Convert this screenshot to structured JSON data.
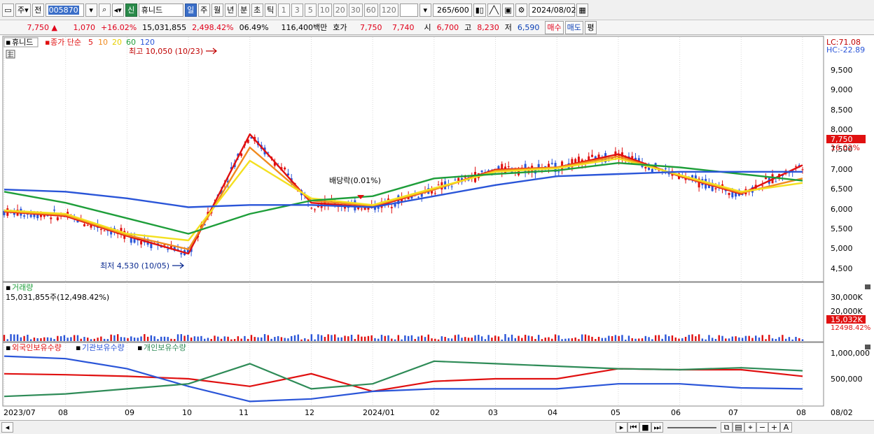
{
  "toolbar": {
    "market_btn": "주",
    "period_btn": "전",
    "stock_code": "005870",
    "badge_new": "신",
    "stock_name": "휴니드",
    "periods": [
      "일",
      "주",
      "월",
      "년",
      "분",
      "초",
      "틱"
    ],
    "active_period": "일",
    "minutes": [
      "1",
      "3",
      "5",
      "10",
      "20",
      "30",
      "60",
      "120"
    ],
    "count": "265",
    "count_max": "/600",
    "date": "2024/08/02"
  },
  "quote": {
    "price": "7,750",
    "change": "1,070",
    "change_pct": "+16.02%",
    "volume": "15,031,855",
    "vol_ratio": "2,498.42%",
    "turnover": "06.49%",
    "amount": "116,400백만",
    "hoga_label": "호가",
    "ask": "7,750",
    "bid": "7,740",
    "open_label": "시",
    "open": "6,700",
    "high_label": "고",
    "high": "8,230",
    "low_label": "저",
    "low": "6,590",
    "buy_btn": "매수",
    "sell_btn": "매도",
    "eval_btn": "평"
  },
  "price_panel": {
    "legend_name": "휴니드",
    "legend_ma": "종가 단순",
    "ma_periods": [
      "5",
      "10",
      "20",
      "60",
      "120"
    ],
    "ma_colors": [
      "#e01010",
      "#f08a1e",
      "#f4e020",
      "#1e9e3a",
      "#2a55d8"
    ],
    "high_annot": "최고 10,050 (10/23)",
    "low_annot": "최저 4,530 (10/05)",
    "dividend_annot": "배당락(0.01%)",
    "lc": "LC:71.08",
    "hc": "HC:-22.89",
    "last_price_tag": "7,750",
    "last_pct_tag": "16.02%",
    "y_ticks": [
      "9,500",
      "9,000",
      "8,500",
      "8,000",
      "7,500",
      "7,000",
      "6,500",
      "6,000",
      "5,500",
      "5,000",
      "4,500"
    ]
  },
  "volume_panel": {
    "title": "거래량",
    "value_text": "15,031,855주(12,498.42%)",
    "y_ticks": [
      "30,000K",
      "20,000K"
    ],
    "last_tag": "15,032K",
    "last_pct_tag": "12498.42%"
  },
  "holdings_panel": {
    "legend": [
      "외국인보유수량",
      "기관보유수량",
      "개인보유수량"
    ],
    "legend_colors": [
      "#e01010",
      "#2a55d8",
      "#2e8b57"
    ],
    "y_ticks": [
      "1,000,000",
      "500,000"
    ]
  },
  "x_axis": {
    "labels": [
      "2023/07",
      "08",
      "09",
      "10",
      "11",
      "12",
      "2024/01",
      "02",
      "03",
      "04",
      "05",
      "06",
      "07",
      "08"
    ],
    "right_label": "08/02"
  },
  "chart_data": {
    "type": "line",
    "title": "휴니드",
    "x": [
      "2023/07",
      "08",
      "09",
      "10",
      "11",
      "12",
      "2024/01",
      "02",
      "03",
      "04",
      "05",
      "06",
      "07",
      "08"
    ],
    "ylim": [
      4400,
      9800
    ],
    "series": [
      {
        "name": "5",
        "values": [
          5950,
          5850,
          5400,
          5000,
          7700,
          6150,
          6050,
          6450,
          6900,
          6950,
          7250,
          6750,
          6350,
          7000
        ]
      },
      {
        "name": "10",
        "values": [
          5960,
          5870,
          5420,
          5100,
          7400,
          6200,
          6080,
          6450,
          6880,
          6950,
          7200,
          6760,
          6370,
          6700
        ]
      },
      {
        "name": "20",
        "values": [
          5980,
          5900,
          5450,
          5300,
          7100,
          6250,
          6100,
          6480,
          6850,
          6930,
          7150,
          6780,
          6400,
          6600
        ]
      },
      {
        "name": "60",
        "values": [
          6400,
          6150,
          5800,
          5450,
          5900,
          6200,
          6300,
          6700,
          6800,
          6880,
          7050,
          6950,
          6800,
          6650
        ]
      },
      {
        "name": "120",
        "values": [
          6450,
          6400,
          6250,
          6050,
          6100,
          6100,
          6050,
          6300,
          6550,
          6750,
          6800,
          6850,
          6850,
          6850
        ]
      }
    ]
  }
}
